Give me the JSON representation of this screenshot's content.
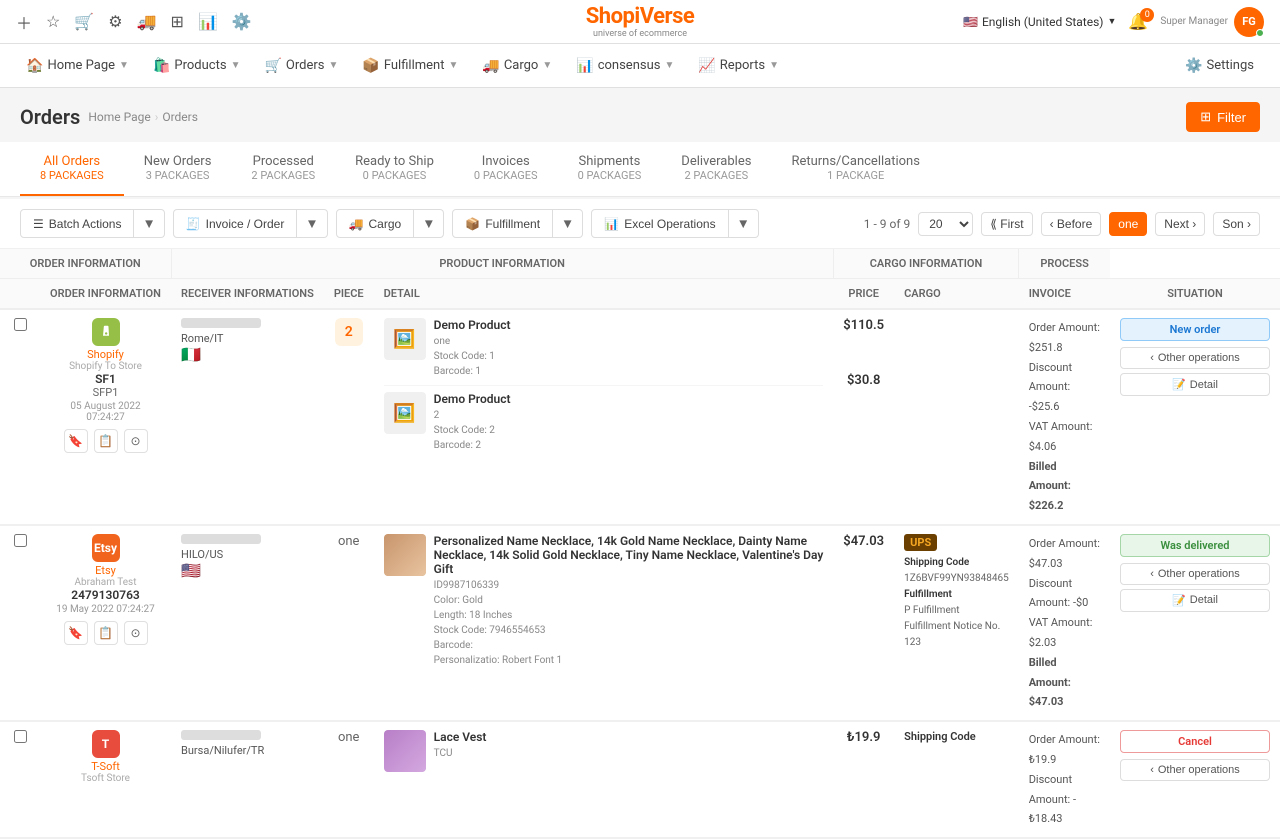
{
  "app": {
    "logo": "ShopiVerse",
    "logo_sub": "universe of ecommerce",
    "lang": "English (United States)",
    "bell_count": "0",
    "user_name": "FG",
    "user_display": "Super Manager"
  },
  "nav": {
    "items": [
      {
        "id": "home",
        "label": "Home Page",
        "icon": "🏠",
        "has_dropdown": true
      },
      {
        "id": "products",
        "label": "Products",
        "icon": "🛍️",
        "has_dropdown": true
      },
      {
        "id": "orders",
        "label": "Orders",
        "icon": "🛒",
        "has_dropdown": true
      },
      {
        "id": "fulfillment",
        "label": "Fulfillment",
        "icon": "📦",
        "has_dropdown": true
      },
      {
        "id": "cargo",
        "label": "Cargo",
        "icon": "🚚",
        "has_dropdown": true
      },
      {
        "id": "consensus",
        "label": "consensus",
        "icon": "📊",
        "has_dropdown": true
      },
      {
        "id": "reports",
        "label": "Reports",
        "icon": "📈",
        "has_dropdown": true
      },
      {
        "id": "settings",
        "label": "Settings",
        "icon": "⚙️",
        "has_dropdown": false
      }
    ]
  },
  "page": {
    "title": "Orders",
    "breadcrumb": [
      "Home Page",
      "Orders"
    ],
    "filter_btn": "Filter"
  },
  "tabs": [
    {
      "id": "all",
      "label": "All Orders",
      "count": "8 PACKAGES",
      "active": true
    },
    {
      "id": "new",
      "label": "New Orders",
      "count": "3 PACKAGES",
      "active": false
    },
    {
      "id": "processed",
      "label": "Processed",
      "count": "2 PACKAGES",
      "active": false
    },
    {
      "id": "ready",
      "label": "Ready to Ship",
      "count": "0 PACKAGES",
      "active": false
    },
    {
      "id": "invoices",
      "label": "Invoices",
      "count": "0 PACKAGES",
      "active": false
    },
    {
      "id": "shipments",
      "label": "Shipments",
      "count": "0 PACKAGES",
      "active": false
    },
    {
      "id": "deliverables",
      "label": "Deliverables",
      "count": "2 PACKAGES",
      "active": false
    },
    {
      "id": "returns",
      "label": "Returns/Cancellations",
      "count": "1 PACKAGE",
      "active": false
    }
  ],
  "toolbar": {
    "batch_actions": "Batch Actions",
    "invoice_order": "Invoice / Order",
    "cargo": "Cargo",
    "fulfillment": "Fulfillment",
    "excel_operations": "Excel Operations",
    "page_info": "1 - 9 of 9",
    "page_size": "20",
    "pagination": [
      "First",
      "Before",
      "one",
      "Next ›",
      "Son ›"
    ],
    "active_page": "one"
  },
  "table": {
    "section_headers": [
      "ORDER INFORMATION",
      "PRODUCT INFORMATION",
      "CARGO INFORMATION",
      "PROCESS"
    ],
    "col_headers": [
      "ORDER INFORMATION",
      "RECEIVER INFORMATIONS",
      "PIECE",
      "DETAIL",
      "PRICE",
      "CARGO",
      "INVOICE",
      "SITUATION"
    ],
    "rows": [
      {
        "id": "row1",
        "store_type": "shopify",
        "store_name": "Shopify",
        "store_link": "Shopify To Store",
        "order_code": "SF1",
        "order_ref": "SFP1",
        "order_date": "05 August 2022 07:24:27",
        "receiver_location": "Rome/IT",
        "receiver_flag": "🇮🇹",
        "piece": "2",
        "products": [
          {
            "name": "Demo Product",
            "meta_lines": [
              "one",
              "Stock Code: 1",
              "Barcode: 1"
            ],
            "price": "$110.5"
          },
          {
            "name": "Demo Product",
            "meta_lines": [
              "2",
              "Stock Code: 2",
              "Barcode: 2"
            ],
            "price": "$30.8"
          }
        ],
        "cargo": "",
        "cargo_detail": "",
        "order_amount": "$251.8",
        "discount_amount": "-$25.6",
        "vat_amount": "$4.06",
        "billed_amount": "$226.2",
        "status": "New order",
        "status_class": "status-new",
        "other_ops": "Other operations",
        "detail": "Detail"
      },
      {
        "id": "row2",
        "store_type": "etsy",
        "store_name": "Etsy",
        "store_link": "Abraham Test",
        "order_code": "2479130763",
        "order_ref": "",
        "order_date": "19 May 2022 07:24:27",
        "receiver_location": "HILO/US",
        "receiver_flag": "🇺🇸",
        "piece": "one",
        "products": [
          {
            "name": "Personalized Name Necklace, 14k Gold Name Necklace, Dainty Name Necklace, 14k Solid Gold Necklace, Tiny Name Necklace, Valentine's Day Gift",
            "meta_lines": [
              "ID9987106339",
              "Color: Gold",
              "Length: 18 Inches",
              "Stock Code: 7946554653",
              "Barcode:",
              "Personalizatio: Robert Font 1"
            ],
            "price": "$47.03",
            "has_img": true
          }
        ],
        "cargo": "UPS",
        "shipping_code": "Shipping Code",
        "shipping_code_val": "1Z6BVF99YN93848465",
        "cargo_type": "Fulfillment",
        "cargo_p": "P Fulfillment",
        "fulfillment_notice": "Fulfillment Notice No.",
        "fulfillment_notice_no": "123",
        "order_amount": "$47.03",
        "discount_amount": "-$0",
        "vat_amount": "$2.03",
        "billed_amount": "$47.03",
        "status": "Was delivered",
        "status_class": "status-delivered",
        "other_ops": "Other operations",
        "detail": "Detail"
      },
      {
        "id": "row3",
        "store_type": "tsoft",
        "store_name": "T-Soft",
        "store_link": "Tsoft Store",
        "order_code": "",
        "order_ref": "",
        "order_date": "",
        "receiver_location": "Bursa/Nilufer/TR",
        "receiver_flag": "",
        "piece": "one",
        "products": [
          {
            "name": "Lace Vest",
            "meta_lines": [
              "TCU"
            ],
            "price": "₺19.9",
            "has_img": true
          }
        ],
        "cargo": "Shipping Code",
        "order_amount": "₺19.9",
        "discount_amount": "-₺18.43",
        "vat_amount": "",
        "billed_amount": "",
        "status": "Cancel",
        "status_class": "status-cancel",
        "other_ops": "Other operations",
        "detail": ""
      }
    ]
  }
}
